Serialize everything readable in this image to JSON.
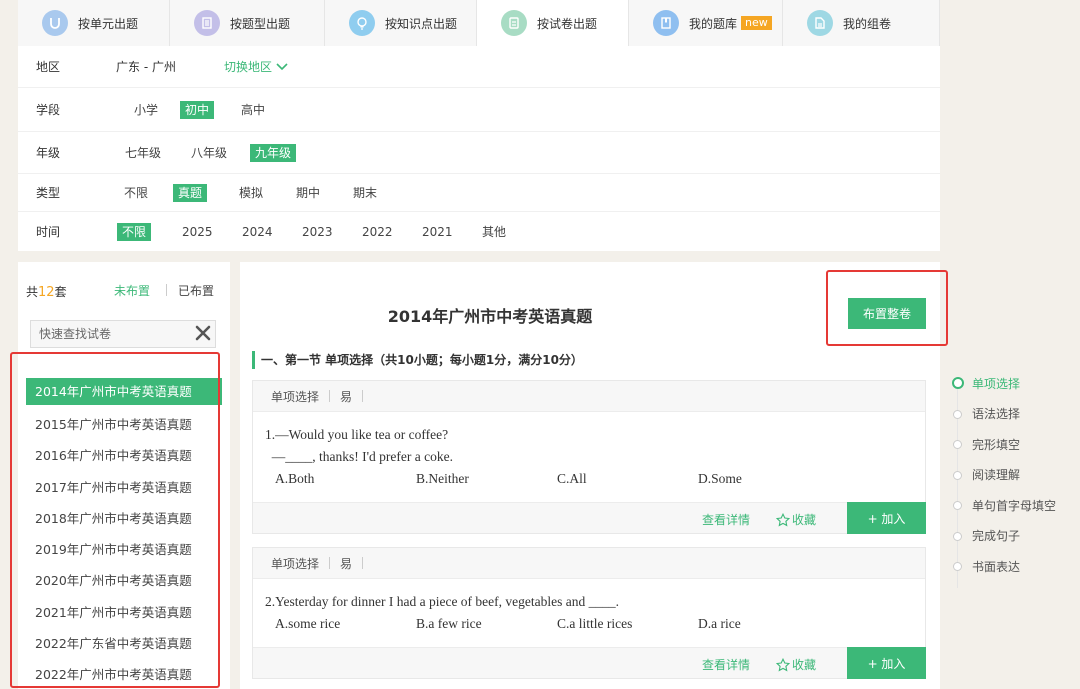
{
  "tabs": [
    {
      "label": "按单元出题",
      "icon": "unit-icon",
      "color": "#a9c9ee"
    },
    {
      "label": "按题型出题",
      "icon": "document-icon",
      "color": "#c3bfe8"
    },
    {
      "label": "按知识点出题",
      "icon": "lightbulb-icon",
      "color": "#8fcdef"
    },
    {
      "label": "按试卷出题",
      "icon": "paper-icon",
      "color": "#a8dcc4"
    },
    {
      "label": "我的题库",
      "icon": "book-icon",
      "color": "#8fbff0",
      "badge": "new"
    },
    {
      "label": "我的组卷",
      "icon": "file-icon",
      "color": "#9ed8e4"
    }
  ],
  "filters": {
    "region": {
      "label": "地区",
      "value": "广东 - 广州",
      "switch_label": "切换地区"
    },
    "stage": {
      "label": "学段",
      "options": [
        "小学",
        "初中",
        "高中"
      ],
      "selected": "初中"
    },
    "grade": {
      "label": "年级",
      "options": [
        "七年级",
        "八年级",
        "九年级"
      ],
      "selected": "九年级"
    },
    "type": {
      "label": "类型",
      "options": [
        "不限",
        "真题",
        "模拟",
        "期中",
        "期末"
      ],
      "selected": "真题"
    },
    "time": {
      "label": "时间",
      "options": [
        "不限",
        "2025",
        "2024",
        "2023",
        "2022",
        "2021",
        "其他"
      ],
      "selected": "不限"
    }
  },
  "left_panel": {
    "count_prefix": "共",
    "count": "12",
    "count_suffix": "套",
    "unassigned_label": "未布置",
    "assigned_label": "已布置",
    "search_placeholder": "快速查找试卷",
    "papers": [
      "2014年广州市中考英语真题",
      "2015年广州市中考英语真题",
      "2016年广州市中考英语真题",
      "2017年广州市中考英语真题",
      "2018年广州市中考英语真题",
      "2019年广州市中考英语真题",
      "2020年广州市中考英语真题",
      "2021年广州市中考英语真题",
      "2022年广东省中考英语真题",
      "2022年广州市中考英语真题"
    ]
  },
  "main": {
    "title": "2014年广州市中考英语真题",
    "assign_all_label": "布置整卷",
    "section_title": "一、第一节 单项选择（共10小题；每小题1分，满分10分）",
    "questions": [
      {
        "type": "单项选择",
        "difficulty": "易",
        "lines": [
          "1.—Would you like tea or coffee?",
          "  —____, thanks! I'd prefer a coke."
        ],
        "options": [
          "A.Both",
          "B.Neither",
          "C.All",
          "D.Some"
        ]
      },
      {
        "type": "单项选择",
        "difficulty": "易",
        "lines": [
          "2.Yesterday for dinner I had a piece of beef, vegetables and ____."
        ],
        "options": [
          "A.some rice",
          "B.a few rice",
          "C.a little rices",
          "D.a rice"
        ]
      }
    ],
    "detail_label": "查看详情",
    "favorite_label": "收藏",
    "add_label": "+ 加入"
  },
  "right_nav": {
    "items": [
      "单项选择",
      "语法选择",
      "完形填空",
      "阅读理解",
      "单句首字母填空",
      "完成句子",
      "书面表达"
    ],
    "selected": "单项选择"
  },
  "colors": {
    "accent": "#3cb878",
    "highlight": "#e53935",
    "badge": "#f5a623"
  }
}
